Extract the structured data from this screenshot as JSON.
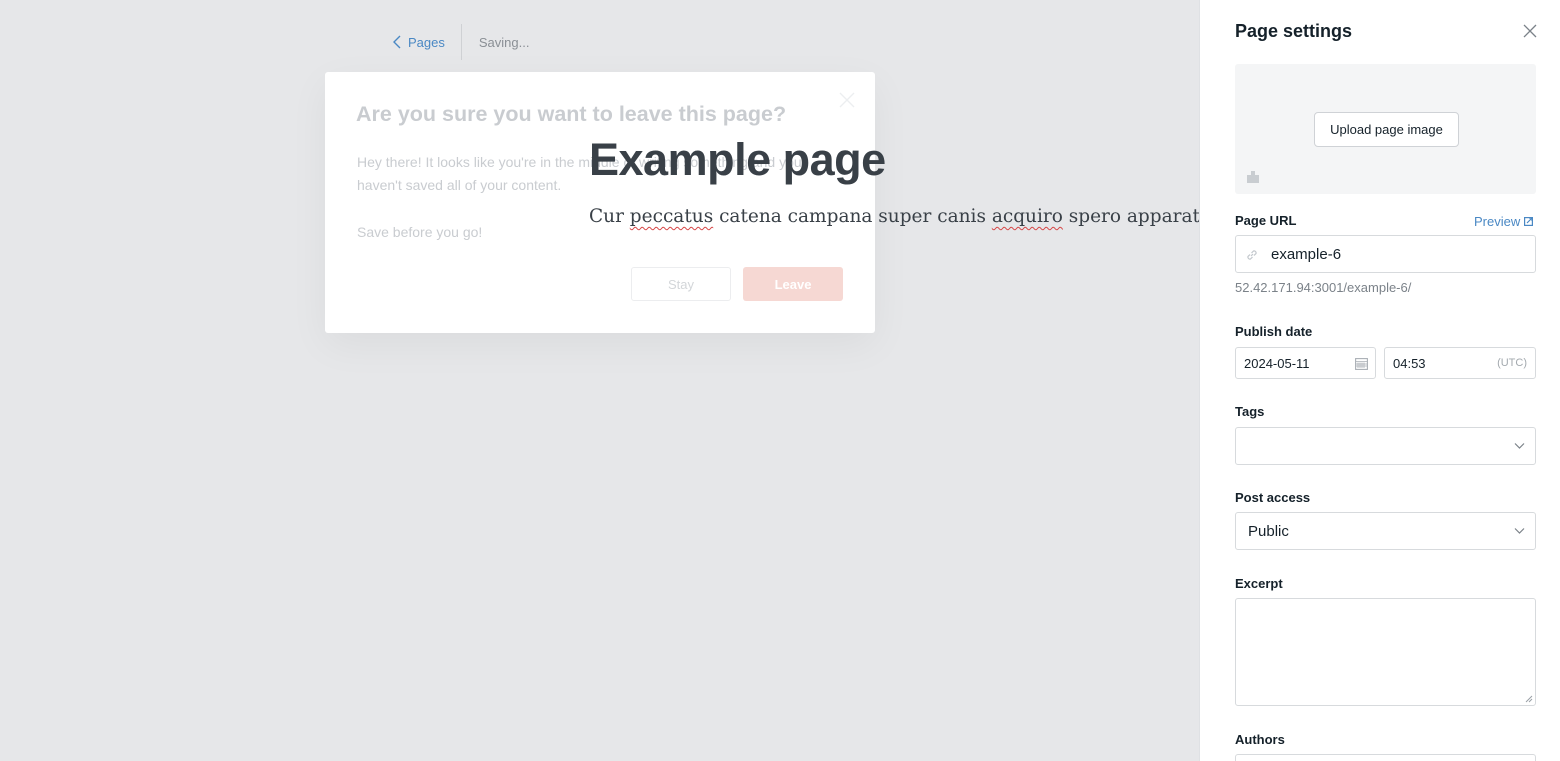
{
  "editor": {
    "back_label": "Pages",
    "status": "Saving...",
    "title": "Example page",
    "body_parts": [
      "Cur ",
      "peccatus",
      " catena campana super canis ",
      "acquiro",
      " spero apparatus."
    ]
  },
  "modal": {
    "title": "Are you sure you want to leave this page?",
    "text_1": "Hey there! It looks like you're in the middle of writing something and you haven't saved all of your content.",
    "text_2": "Save before you go!",
    "stay_label": "Stay",
    "leave_label": "Leave"
  },
  "settings": {
    "title": "Page settings",
    "upload_label": "Upload page image",
    "url_label": "Page URL",
    "preview_label": "Preview",
    "url_value": "example-6",
    "url_hint": "52.42.171.94:3001/example-6/",
    "publish_label": "Publish date",
    "date_value": "2024-05-11",
    "time_value": "04:53",
    "timezone": "(UTC)",
    "tags_label": "Tags",
    "access_label": "Post access",
    "access_value": "Public",
    "excerpt_label": "Excerpt",
    "authors_label": "Authors"
  },
  "colors": {
    "accent": "#4a88c4",
    "leave_button": "#f6d8d3",
    "editor_bg": "#e6e7e9"
  },
  "icons": [
    "chevron-left-icon",
    "close-icon",
    "image-icon",
    "external-link-icon",
    "link-icon",
    "calendar-icon",
    "chevron-down-icon"
  ]
}
